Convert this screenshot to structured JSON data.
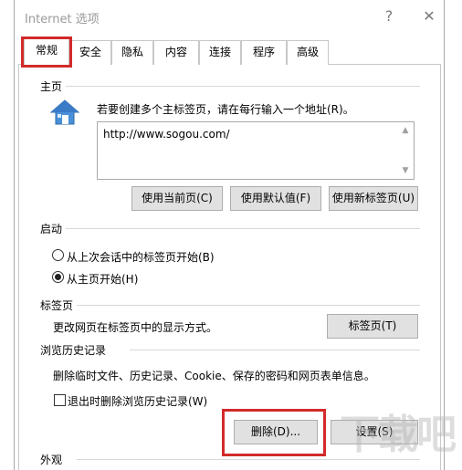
{
  "window": {
    "title": "Internet 选项",
    "help_label": "?",
    "close_label": "✕"
  },
  "tabs": [
    {
      "label": "常规",
      "active": true
    },
    {
      "label": "安全"
    },
    {
      "label": "隐私"
    },
    {
      "label": "内容"
    },
    {
      "label": "连接"
    },
    {
      "label": "程序"
    },
    {
      "label": "高级"
    }
  ],
  "homepage": {
    "section_label": "主页",
    "instruction": "若要创建多个主标签页，请在每行输入一个地址(R)。",
    "url_value": "http://www.sogou.com/",
    "buttons": {
      "use_current": "使用当前页(C)",
      "use_default": "使用默认值(F)",
      "use_new_tab": "使用新标签页(U)"
    }
  },
  "startup": {
    "section_label": "启动",
    "option_last_session": "从上次会话中的标签页开始(B)",
    "option_homepage": "从主页开始(H)",
    "selected": "homepage"
  },
  "tabs_section": {
    "section_label": "标签页",
    "description": "更改网页在标签页中的显示方式。",
    "button": "标签页(T)"
  },
  "history": {
    "section_label": "浏览历史记录",
    "description": "删除临时文件、历史记录、Cookie、保存的密码和网页表单信息。",
    "checkbox_label": "退出时删除浏览历史记录(W)",
    "checkbox_checked": false,
    "delete_button": "删除(D)...",
    "settings_button": "设置(S)"
  },
  "appearance": {
    "section_label": "外观"
  },
  "watermark_text": "下载吧",
  "colors": {
    "highlight_red": "#d32a2a",
    "button_face": "#e1e1e1"
  }
}
